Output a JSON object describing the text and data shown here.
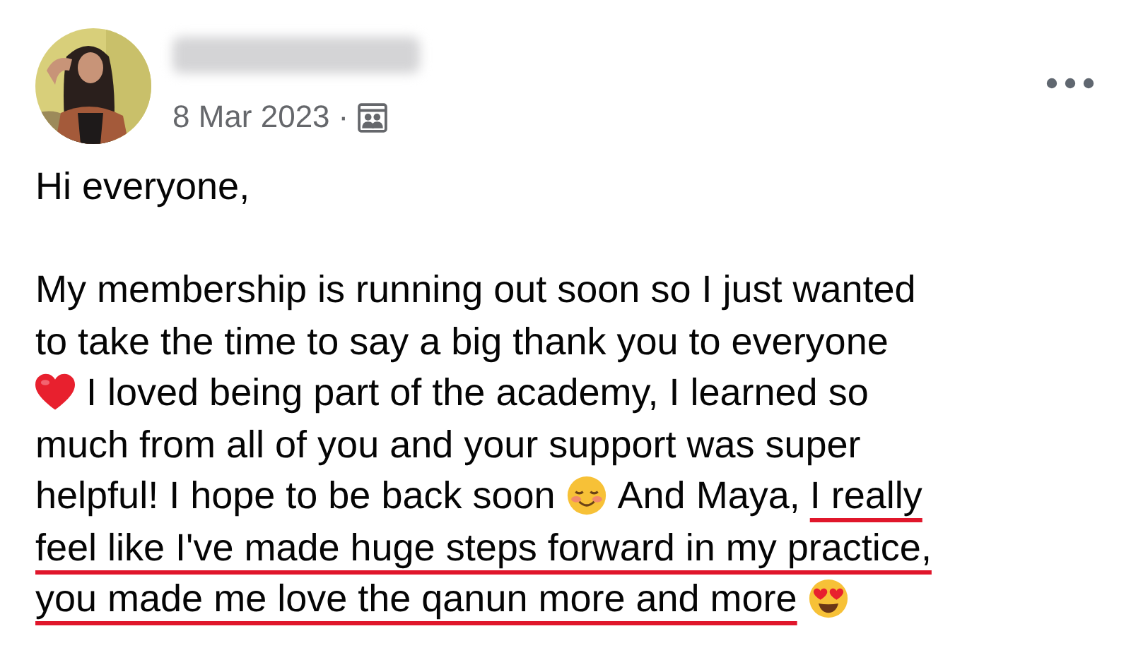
{
  "post": {
    "date": "8 Mar 2023",
    "separator": "·",
    "paragraphs": [
      [
        [
          {
            "kind": "text",
            "text": "Hi everyone,",
            "underlined": false
          }
        ]
      ],
      [
        [
          {
            "kind": "text",
            "text": "My membership is running out soon so I just wanted",
            "underlined": false
          }
        ],
        [
          {
            "kind": "text",
            "text": "to take the time to say a big thank you to everyone",
            "underlined": false
          }
        ],
        [
          {
            "kind": "heart"
          },
          {
            "kind": "text",
            "text": "I loved being part of the academy, I learned so",
            "underlined": false
          }
        ],
        [
          {
            "kind": "text",
            "text": "much from all of you and your support was super",
            "underlined": false
          }
        ],
        [
          {
            "kind": "text",
            "text": "helpful! I hope to be back soon",
            "underlined": false
          },
          {
            "kind": "blush"
          },
          {
            "kind": "text",
            "text": "And Maya,",
            "underlined": false
          },
          {
            "kind": "text",
            "text": "I really",
            "underlined": true
          }
        ],
        [
          {
            "kind": "text",
            "text": "feel like I've made huge steps forward in my practice,",
            "underlined": true
          }
        ],
        [
          {
            "kind": "text",
            "text": "you made me love the qanun more and more",
            "underlined": true
          },
          {
            "kind": "heart-eyes"
          }
        ]
      ]
    ]
  }
}
